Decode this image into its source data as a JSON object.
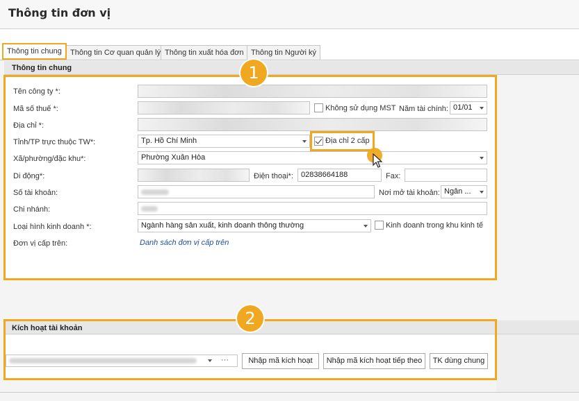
{
  "page_title": "Thông tin đơn vị",
  "tabs": [
    {
      "label": "Thông tin chung",
      "active": true
    },
    {
      "label": "Thông tin Cơ quan quản lý",
      "active": false
    },
    {
      "label": "Thông tin xuất hóa đơn",
      "active": false
    },
    {
      "label": "Thông tin Người ký",
      "active": false
    }
  ],
  "section1": {
    "title": "Thông tin chung",
    "badge": "1",
    "fields": {
      "company_name": {
        "label": "Tên công ty *:"
      },
      "tax_code": {
        "label": "Mã số thuế *:"
      },
      "no_tax_code": {
        "label": "Không sử dụng MST",
        "checked": false
      },
      "fiscal_year": {
        "label": "Năm tài chính:",
        "value": "01/01"
      },
      "address": {
        "label": "Địa chỉ *:"
      },
      "province": {
        "label": "Tỉnh/TP trực thuộc TW*:",
        "value": "Tp. Hồ Chí Minh"
      },
      "two_level_address": {
        "label": "Địa chỉ 2 cấp",
        "checked": true
      },
      "ward": {
        "label": "Xã/phường/đặc khu*:",
        "value": "Phường Xuân Hòa"
      },
      "mobile": {
        "label": "Di động*:"
      },
      "phone": {
        "label": "Điện thoại*:",
        "value": "02838664188"
      },
      "fax": {
        "label": "Fax:",
        "value": ""
      },
      "account_no": {
        "label": "Số tài khoản:"
      },
      "bank": {
        "label": "Nơi mở tài khoản:",
        "value": "Ngân ..."
      },
      "branch": {
        "label": "Chi nhánh:"
      },
      "business_type": {
        "label": "Loại hình kinh doanh *:",
        "value": "Ngành hàng sản xuất, kinh doanh thông thường"
      },
      "economic_zone": {
        "label": "Kinh doanh trong khu kinh tế",
        "checked": false
      },
      "parent_unit": {
        "label": "Đơn vị cấp trên:",
        "link": "Danh sách đơn vị cấp trên"
      }
    }
  },
  "section2": {
    "title": "Kích hoạt tài khoản",
    "badge": "2",
    "ellipsis": "···",
    "buttons": {
      "enter_code": "Nhập mã kích hoạt",
      "enter_next_code": "Nhập mã kích hoạt tiếp theo",
      "shared_account": "TK dùng chung"
    }
  },
  "colors": {
    "highlight": "#f0a820",
    "link": "#1f4fa0"
  }
}
